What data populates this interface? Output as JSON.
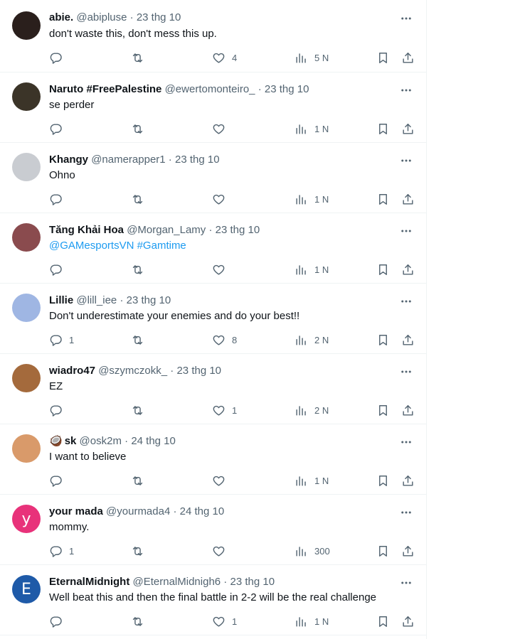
{
  "tweets": [
    {
      "name": "abie.",
      "handle": "@abipluse",
      "date": "23 thg 10",
      "text": "don't waste this, don't mess this up.",
      "replies": "",
      "retweets": "",
      "likes": "4",
      "views": "5 N",
      "avatar_color": "#2a1f1c",
      "avatar_letter": ""
    },
    {
      "name": "Naruto #FreePalestine",
      "handle": "@ewertomonteiro_",
      "date": "23 thg 10",
      "text": "se perder",
      "replies": "",
      "retweets": "",
      "likes": "",
      "views": "1 N",
      "avatar_color": "#3b3428",
      "avatar_letter": ""
    },
    {
      "name": "Khangy",
      "handle": "@namerapper1",
      "date": "23 thg 10",
      "text": "Ohno",
      "replies": "",
      "retweets": "",
      "likes": "",
      "views": "1 N",
      "avatar_color": "#c9ccd1",
      "avatar_letter": ""
    },
    {
      "name": "Tăng Khải Hoa",
      "handle": "@Morgan_Lamy",
      "date": "23 thg 10",
      "text": "",
      "links": [
        "@GAMesportsVN",
        "#Gamtime"
      ],
      "replies": "",
      "retweets": "",
      "likes": "",
      "views": "1 N",
      "avatar_color": "#8a4b4e",
      "avatar_letter": ""
    },
    {
      "name": "Lillie",
      "handle": "@lill_iee",
      "date": "23 thg 10",
      "text": "Don't underestimate your enemies and do your best!!",
      "replies": "1",
      "retweets": "",
      "likes": "8",
      "views": "2 N",
      "avatar_color": "#9fb6e3",
      "avatar_letter": ""
    },
    {
      "name": "wiadro47",
      "handle": "@szymczokk_",
      "date": "23 thg 10",
      "text": "EZ",
      "replies": "",
      "retweets": "",
      "likes": "1",
      "views": "2 N",
      "avatar_color": "#a46a3c",
      "avatar_letter": ""
    },
    {
      "name": "sk",
      "name_emoji": "🥥",
      "handle": "@osk2m",
      "date": "24 thg 10",
      "text": "I want to believe",
      "replies": "",
      "retweets": "",
      "likes": "",
      "views": "1 N",
      "avatar_color": "#d99a6a",
      "avatar_letter": ""
    },
    {
      "name": "your mada",
      "handle": "@yourmada4",
      "date": "24 thg 10",
      "text": "mommy.",
      "replies": "1",
      "retweets": "",
      "likes": "",
      "views": "300",
      "avatar_color": "#e8327a",
      "avatar_letter": "y"
    },
    {
      "name": "EternalMidnight",
      "handle": "@EternalMidnigh6",
      "date": "23 thg 10",
      "text": "Well beat this and then the final battle in 2-2 will be the real challenge",
      "replies": "",
      "retweets": "",
      "likes": "1",
      "views": "1 N",
      "avatar_color": "#1e5aa8",
      "avatar_letter": "E"
    }
  ],
  "separator": " · "
}
